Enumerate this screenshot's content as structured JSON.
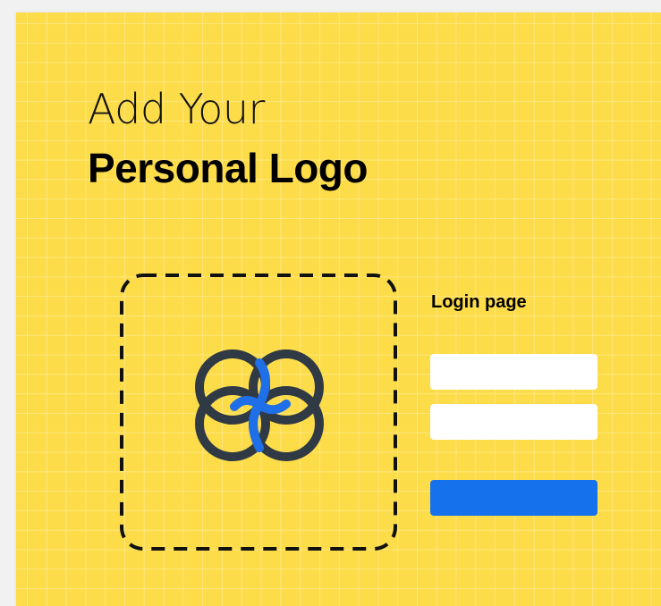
{
  "heading": {
    "line1": "Add Your",
    "line2": "Personal Logo"
  },
  "logo": {
    "icon": "four-circle-logo-icon",
    "ring_color": "#2f3a44",
    "accent_color": "#1e6fe8",
    "frame_style": "dashed"
  },
  "login": {
    "title": "Login page",
    "username": {
      "value": "",
      "placeholder": ""
    },
    "password": {
      "value": "",
      "placeholder": ""
    },
    "submit_label": "",
    "button_color": "#1571ec",
    "field_color": "#ffffff"
  },
  "theme": {
    "background": "#fddc4a",
    "grid_line_color": "#ffffff"
  }
}
